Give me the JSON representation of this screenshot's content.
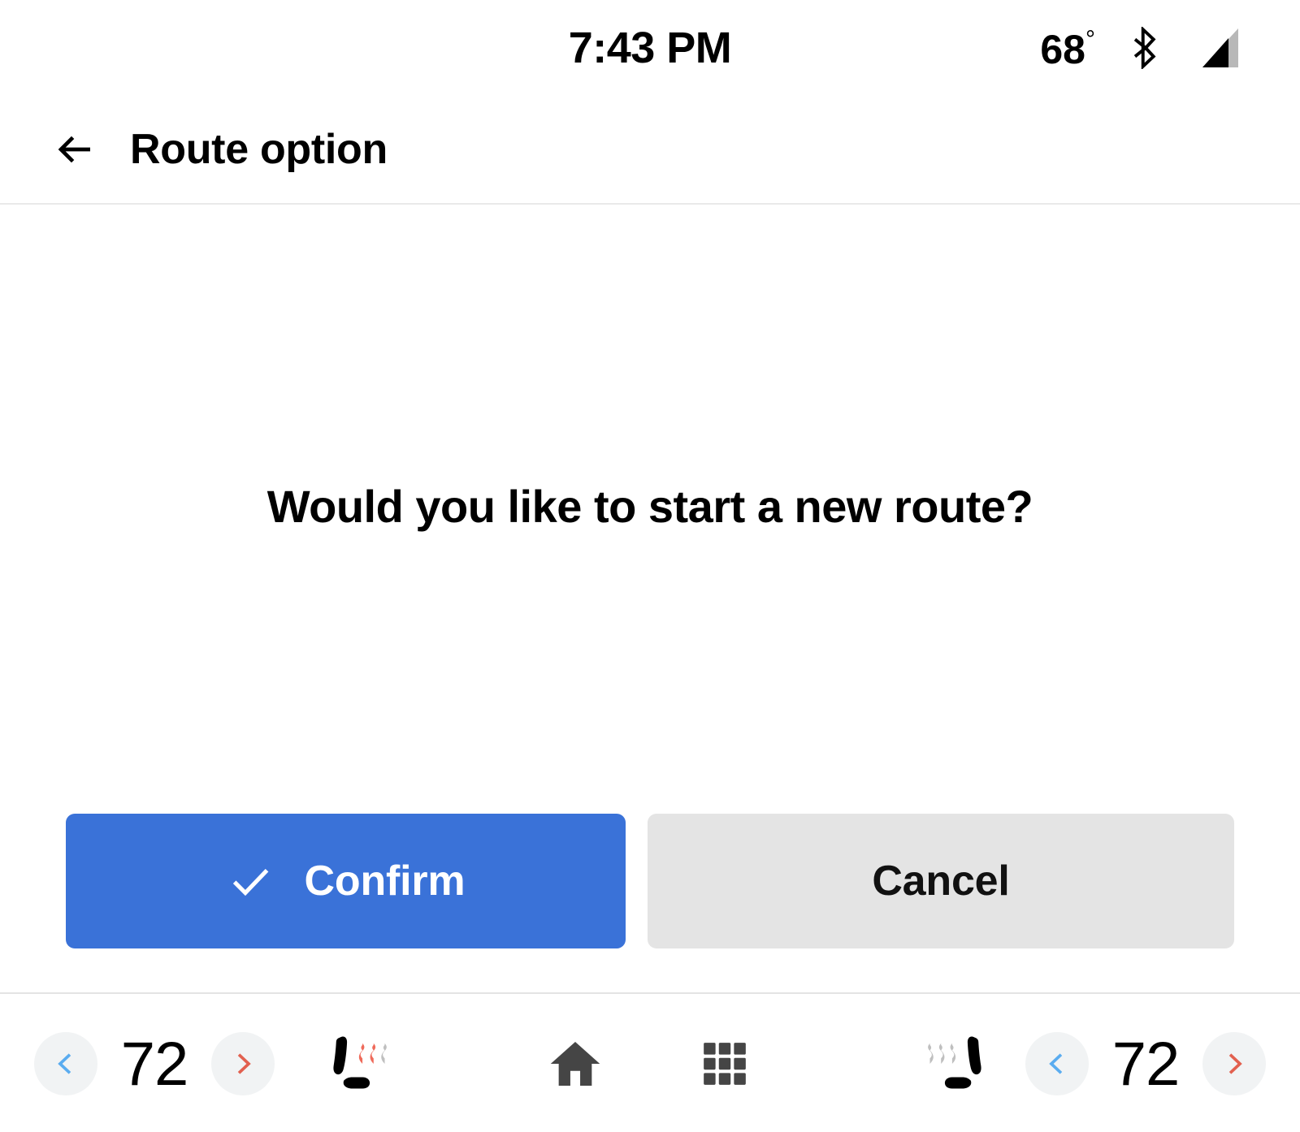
{
  "status_bar": {
    "clock": "7:43 PM",
    "temperature": "68",
    "degree_symbol": "°",
    "bluetooth_icon": "bluetooth-icon",
    "signal_icon": "cellular-signal-icon"
  },
  "app_bar": {
    "back_icon": "back-arrow-icon",
    "title": "Route option"
  },
  "dialog": {
    "prompt": "Would you like to start a new route?",
    "confirm_label": "Confirm",
    "confirm_icon": "check-icon",
    "cancel_label": "Cancel"
  },
  "climate_bar": {
    "left": {
      "decrease_icon": "chevron-left-icon",
      "temperature": "72",
      "increase_icon": "chevron-right-icon",
      "seat_heater_icon": "heated-seat-icon",
      "seat_heater_level": 2
    },
    "right": {
      "seat_heater_icon": "heated-seat-icon",
      "seat_heater_level": 0,
      "decrease_icon": "chevron-left-icon",
      "temperature": "72",
      "increase_icon": "chevron-right-icon"
    },
    "center": {
      "home_icon": "home-icon",
      "apps_icon": "apps-grid-icon"
    }
  },
  "colors": {
    "accent_blue": "#3a72d8",
    "chevron_blue": "#5aacf0",
    "chevron_red": "#e2604f",
    "cancel_gray": "#e4e4e4",
    "circle_gray": "#f1f3f4",
    "icon_dark": "#454545",
    "seat_line_active": "#ef6a5a",
    "seat_line_inactive": "#bfbfbf"
  }
}
